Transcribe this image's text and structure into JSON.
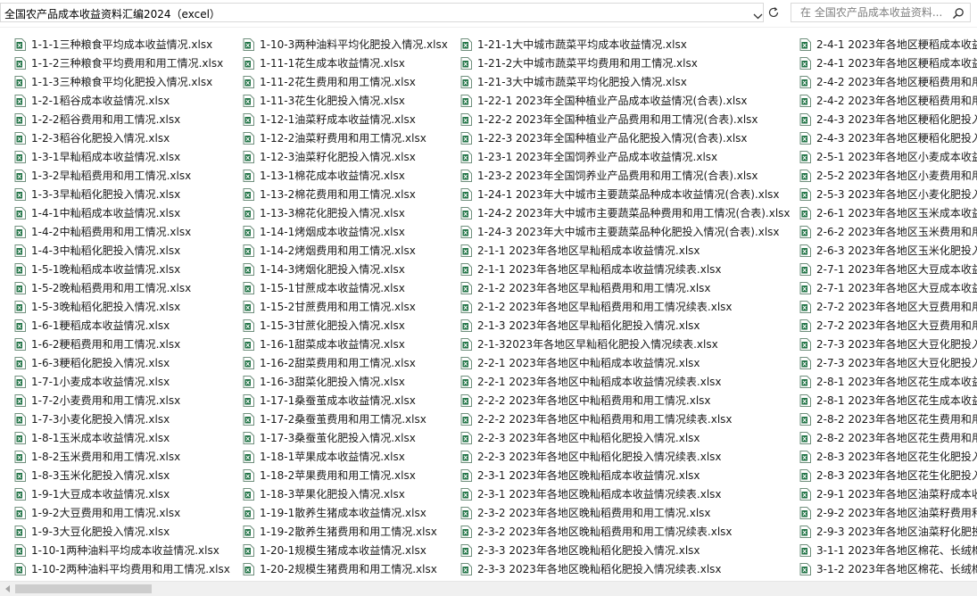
{
  "address": {
    "path": "全国农产品成本收益资料汇编2024（excel）"
  },
  "search": {
    "placeholder": "在 全国农产品成本收益资料..."
  },
  "icons": {
    "dropdown": "chevron-down-icon",
    "refresh": "refresh-icon",
    "search": "search-icon",
    "file": "excel-file-icon",
    "scroll_left": "scroll-left-icon"
  },
  "colors": {
    "excel_green": "#1f7244",
    "text": "#1a1a1a",
    "scroll_thumb": "#cdcdcd"
  },
  "columns": [
    {
      "items": [
        "1-1-1三种粮食平均成本收益情况.xlsx",
        "1-1-2三种粮食平均费用和用工情况.xlsx",
        "1-1-3三种粮食平均化肥投入情况.xlsx",
        "1-2-1稻谷成本收益情况.xlsx",
        "1-2-2稻谷费用和用工情况.xlsx",
        "1-2-3稻谷化肥投入情况.xlsx",
        "1-3-1早籼稻成本收益情况.xlsx",
        "1-3-2早籼稻费用和用工情况.xlsx",
        "1-3-3早籼稻化肥投入情况.xlsx",
        "1-4-1中籼稻成本收益情况.xlsx",
        "1-4-2中籼稻费用和用工情况.xlsx",
        "1-4-3中籼稻化肥投入情况.xlsx",
        "1-5-1晚籼稻成本收益情况.xlsx",
        "1-5-2晚籼稻费用和用工情况.xlsx",
        "1-5-3晚籼稻化肥投入情况.xlsx",
        "1-6-1粳稻成本收益情况.xlsx",
        "1-6-2粳稻费用和用工情况.xlsx",
        "1-6-3粳稻化肥投入情况.xlsx",
        "1-7-1小麦成本收益情况.xlsx",
        "1-7-2小麦费用和用工情况.xlsx",
        "1-7-3小麦化肥投入情况.xlsx",
        "1-8-1玉米成本收益情况.xlsx",
        "1-8-2玉米费用和用工情况.xlsx",
        "1-8-3玉米化肥投入情况.xlsx",
        "1-9-1大豆成本收益情况.xlsx",
        "1-9-2大豆费用和用工情况.xlsx",
        "1-9-3大豆化肥投入情况.xlsx",
        "1-10-1两种油料平均成本收益情况.xlsx",
        "1-10-2两种油料平均费用和用工情况.xlsx"
      ]
    },
    {
      "items": [
        "1-10-3两种油料平均化肥投入情况.xlsx",
        "1-11-1花生成本收益情况.xlsx",
        "1-11-2花生费用和用工情况.xlsx",
        "1-11-3花生化肥投入情况.xlsx",
        "1-12-1油菜籽成本收益情况.xlsx",
        "1-12-2油菜籽费用和用工情况.xlsx",
        "1-12-3油菜籽化肥投入情况.xlsx",
        "1-13-1棉花成本收益情况.xlsx",
        "1-13-2棉花费用和用工情况.xlsx",
        "1-13-3棉花化肥投入情况.xlsx",
        "1-14-1烤烟成本收益情况.xlsx",
        "1-14-2烤烟费用和用工情况.xlsx",
        "1-14-3烤烟化肥投入情况.xlsx",
        "1-15-1甘蔗成本收益情况.xlsx",
        "1-15-2甘蔗费用和用工情况.xlsx",
        "1-15-3甘蔗化肥投入情况.xlsx",
        "1-16-1甜菜成本收益情况.xlsx",
        "1-16-2甜菜费用和用工情况.xlsx",
        "1-16-3甜菜化肥投入情况.xlsx",
        "1-17-1桑蚕茧成本收益情况.xlsx",
        "1-17-2桑蚕茧费用和用工情况.xlsx",
        "1-17-3桑蚕茧化肥投入情况.xlsx",
        "1-18-1苹果成本收益情况.xlsx",
        "1-18-2苹果费用和用工情况.xlsx",
        "1-18-3苹果化肥投入情况.xlsx",
        "1-19-1散养生猪成本收益情况.xlsx",
        "1-19-2散养生猪费用和用工情况.xlsx",
        "1-20-1规模生猪成本收益情况.xlsx",
        "1-20-2规模生猪费用和用工情况.xlsx"
      ]
    },
    {
      "items": [
        "1-21-1大中城市蔬菜平均成本收益情况.xlsx",
        "1-21-2大中城市蔬菜平均费用和用工情况.xlsx",
        "1-21-3大中城市蔬菜平均化肥投入情况.xlsx",
        "1-22-1 2023年全国种植业产品成本收益情况(合表).xlsx",
        "1-22-2 2023年全国种植业产品费用和用工情况(合表).xlsx",
        "1-22-3 2023年全国种植业产品化肥投入情况(合表).xlsx",
        "1-23-1 2023年全国饲养业产品成本收益情况.xlsx",
        "1-23-2 2023年全国饲养业产品费用和用工情况(合表).xlsx",
        "1-24-1 2023年大中城市主要蔬菜品种成本收益情况(合表).xlsx",
        "1-24-2 2023年大中城市主要蔬菜品种费用和用工情况(合表).xlsx",
        "1-24-3 2023年大中城市主要蔬菜品种化肥投入情况(合表).xlsx",
        "2-1-1 2023年各地区早籼稻成本收益情况.xlsx",
        "2-1-1 2023年各地区早籼稻成本收益情况续表.xlsx",
        "2-1-2 2023年各地区早籼稻费用和用工情况.xlsx",
        "2-1-2 2023年各地区早籼稻费用和用工情况续表.xlsx",
        "2-1-3 2023年各地区早籼稻化肥投入情况.xlsx",
        "2-1-32023年各地区早籼稻化肥投入情况续表.xlsx",
        "2-2-1 2023年各地区中籼稻成本收益情况.xlsx",
        "2-2-1 2023年各地区中籼稻成本收益情况续表.xlsx",
        "2-2-2 2023年各地区中籼稻费用和用工情况.xlsx",
        "2-2-2 2023年各地区中籼稻费用和用工情况续表.xlsx",
        "2-2-3 2023年各地区中籼稻化肥投入情况.xlsx",
        "2-2-3 2023年各地区中籼稻化肥投入情况续表.xlsx",
        "2-3-1 2023年各地区晚籼稻成本收益情况.xlsx",
        "2-3-1 2023年各地区晚籼稻成本收益情况续表.xlsx",
        "2-3-2 2023年各地区晚籼稻费用和用工情况.xlsx",
        "2-3-2 2023年各地区晚籼稻费用和用工情况续表.xlsx",
        "2-3-3 2023年各地区晚籼稻化肥投入情况.xlsx",
        "2-3-3 2023年各地区晚籼稻化肥投入情况续表.xlsx"
      ]
    },
    {
      "items": [
        "2-4-1 2023年各地区粳稻成本收益",
        "2-4-1 2023年各地区粳稻成本收益",
        "2-4-2 2023年各地区粳稻费用和用",
        "2-4-2 2023年各地区粳稻费用和用",
        "2-4-3 2023年各地区粳稻化肥投入",
        "2-4-3 2023年各地区粳稻化肥投入",
        "2-5-1 2023年各地区小麦成本收益",
        "2-5-2 2023年各地区小麦费用和用",
        "2-5-3 2023年各地区小麦化肥投入",
        "2-6-1 2023年各地区玉米成本收益",
        "2-6-2 2023年各地区玉米费用和用",
        "2-6-3 2023年各地区玉米化肥投入",
        "2-7-1 2023年各地区大豆成本收益",
        "2-7-1 2023年各地区大豆成本收益",
        "2-7-2 2023年各地区大豆费用和用",
        "2-7-2 2023年各地区大豆费用和用",
        "2-7-3 2023年各地区大豆化肥投入",
        "2-7-3 2023年各地区大豆化肥投入",
        "2-8-1 2023年各地区花生成本收益",
        "2-8-1 2023年各地区花生成本收益",
        "2-8-2 2023年各地区花生费用和用",
        "2-8-2 2023年各地区花生费用和用",
        "2-8-3 2023年各地区花生化肥投入",
        "2-8-3 2023年各地区花生化肥投入",
        "2-9-1 2023年各地区油菜籽成本收",
        "2-9-2 2023年各地区油菜籽费用和",
        "2-9-3 2023年各地区油菜籽化肥投",
        "3-1-1 2023年各地区棉花、长绒棉",
        "3-1-2 2023年各地区棉花、长绒棉"
      ]
    }
  ]
}
